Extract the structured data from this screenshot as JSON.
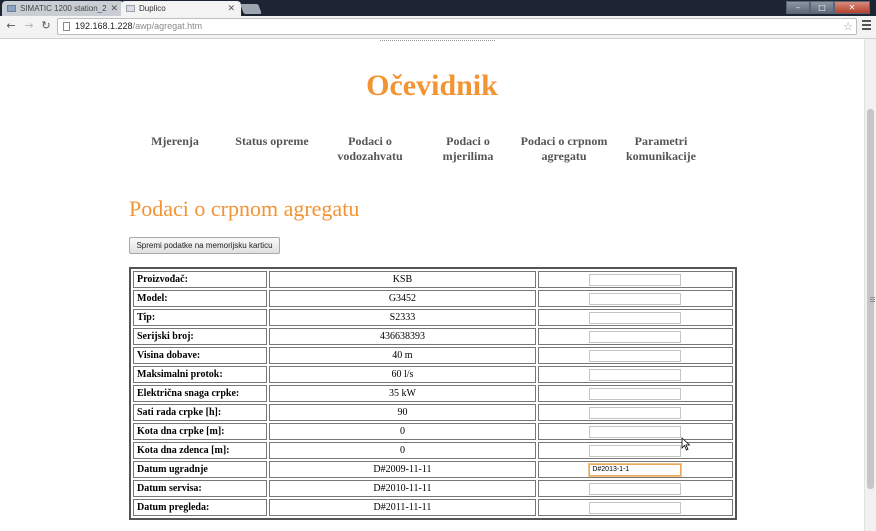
{
  "browser": {
    "tabs": [
      {
        "label": "SIMATIC 1200 station_2",
        "active": false
      },
      {
        "label": "Duplico",
        "active": true
      }
    ],
    "url_host": "192.168.1.228",
    "url_path": "/awp/agregat.htm"
  },
  "page": {
    "site_title": "Očevidnik",
    "nav": [
      {
        "line1": "Mjerenja",
        "line2": ""
      },
      {
        "line1": "Status opreme",
        "line2": ""
      },
      {
        "line1": "Podaci o",
        "line2": "vodozahvatu"
      },
      {
        "line1": "Podaci o",
        "line2": "mjerilima"
      },
      {
        "line1": "Podaci o crpnom",
        "line2": "agregatu"
      },
      {
        "line1": "Parametri",
        "line2": "komunikacije"
      }
    ],
    "section_title": "Podaci o crpnom agregatu",
    "save_button": "Spremi podatke na memorijsku karticu",
    "rows": [
      {
        "label": "Proizvođač:",
        "value": "KSB",
        "input": ""
      },
      {
        "label": "Model:",
        "value": "G3452",
        "input": ""
      },
      {
        "label": "Tip:",
        "value": "S2333",
        "input": ""
      },
      {
        "label": "Serijski broj:",
        "value": "436638393",
        "input": ""
      },
      {
        "label": "Visina dobave:",
        "value": "40 m",
        "input": ""
      },
      {
        "label": "Maksimalni protok:",
        "value": "60 l/s",
        "input": ""
      },
      {
        "label": "Električna snaga crpke:",
        "value": "35 kW",
        "input": ""
      },
      {
        "label": "Sati rada crpke [h]:",
        "value": "90",
        "input": ""
      },
      {
        "label": "Kota dna crpke [m]:",
        "value": "0",
        "input": ""
      },
      {
        "label": "Kota dna zdenca [m]:",
        "value": "0",
        "input": ""
      },
      {
        "label": "Datum ugradnje",
        "value": "D#2009-11-11",
        "input": "D#2013-1-1"
      },
      {
        "label": "Datum servisa:",
        "value": "D#2010-11-11",
        "input": ""
      },
      {
        "label": "Datum pregleda:",
        "value": "D#2011-11-11",
        "input": ""
      }
    ]
  },
  "colors": {
    "accent": "#f39433",
    "chrome": "#1d2433"
  }
}
